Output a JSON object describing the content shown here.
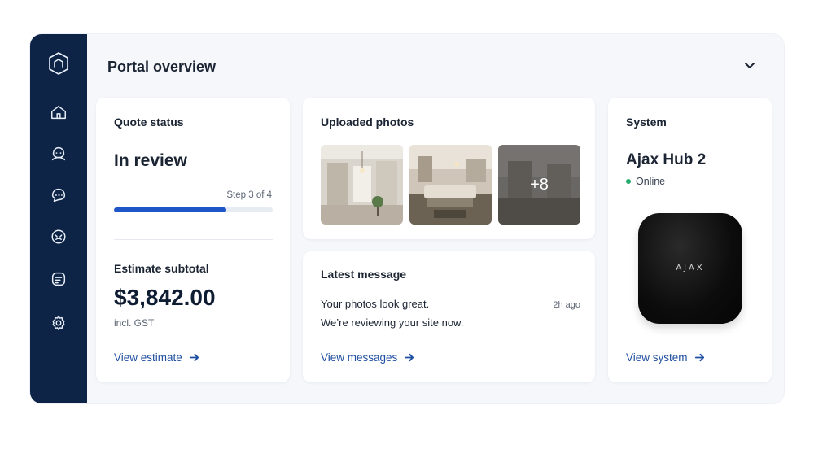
{
  "header": {
    "title": "Portal overview"
  },
  "sidebar": {
    "icons": [
      "logo-icon",
      "home-icon",
      "user-face-icon",
      "chat-icon",
      "face-circle-icon",
      "document-icon",
      "gear-icon"
    ]
  },
  "quote": {
    "title": "Quote status",
    "status": "In review",
    "step_label": "Step 3 of 4",
    "progress": 0.71,
    "estimate_title": "Estimate subtotal",
    "amount": "$3,842.00",
    "amount_note": "incl. GST",
    "link": "View estimate"
  },
  "photos": {
    "title": "Uploaded photos",
    "more": "+8"
  },
  "message": {
    "title": "Latest message",
    "line1": "Your photos look great.",
    "line2": "We’re reviewing your site now.",
    "time": "2h ago",
    "link": "View messages"
  },
  "system": {
    "title": "System",
    "device": "Ajax Hub 2",
    "status": "Online",
    "brand": "AJAX",
    "link": "View system"
  },
  "colors": {
    "sidebar": "#0e2446",
    "accent": "#1e56c8",
    "link": "#1f4fa0",
    "online": "#26a96c"
  }
}
